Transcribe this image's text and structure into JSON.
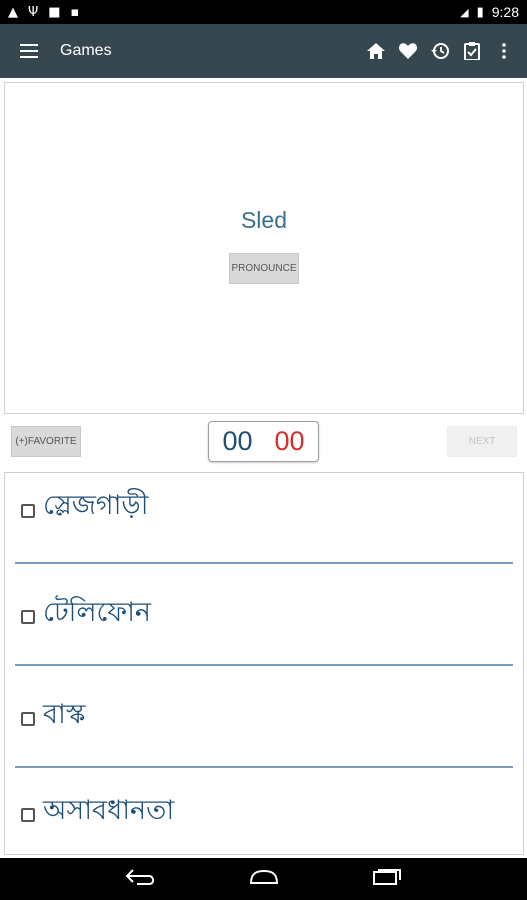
{
  "status_bar": {
    "time": "9:28"
  },
  "app_bar": {
    "title": "Games",
    "menu_icon": "hamburger-icon",
    "actions": [
      "home-icon",
      "heart-icon",
      "history-icon",
      "clipboard-icon",
      "more-vert-icon"
    ]
  },
  "card": {
    "word": "Sled",
    "pronounce_label": "PRONOUNCE"
  },
  "controls": {
    "favorite_label": "(+)FAVORITE",
    "score_correct": "00",
    "score_wrong": "00",
    "next_label": "NEXT"
  },
  "answers": [
    {
      "label": "স্লেজগাড়ী",
      "checked": false
    },
    {
      "label": "টেলিফোন",
      "checked": false
    },
    {
      "label": "বাস্ক",
      "checked": false
    },
    {
      "label": "অসাবধানতা",
      "checked": false
    }
  ],
  "colors": {
    "app_bar": "#37474f",
    "word": "#3a6f8f",
    "answer_text": "#1f4e79",
    "score_correct": "#1f4e79",
    "score_wrong": "#d32f2f",
    "divider": "#7a9bbd"
  }
}
